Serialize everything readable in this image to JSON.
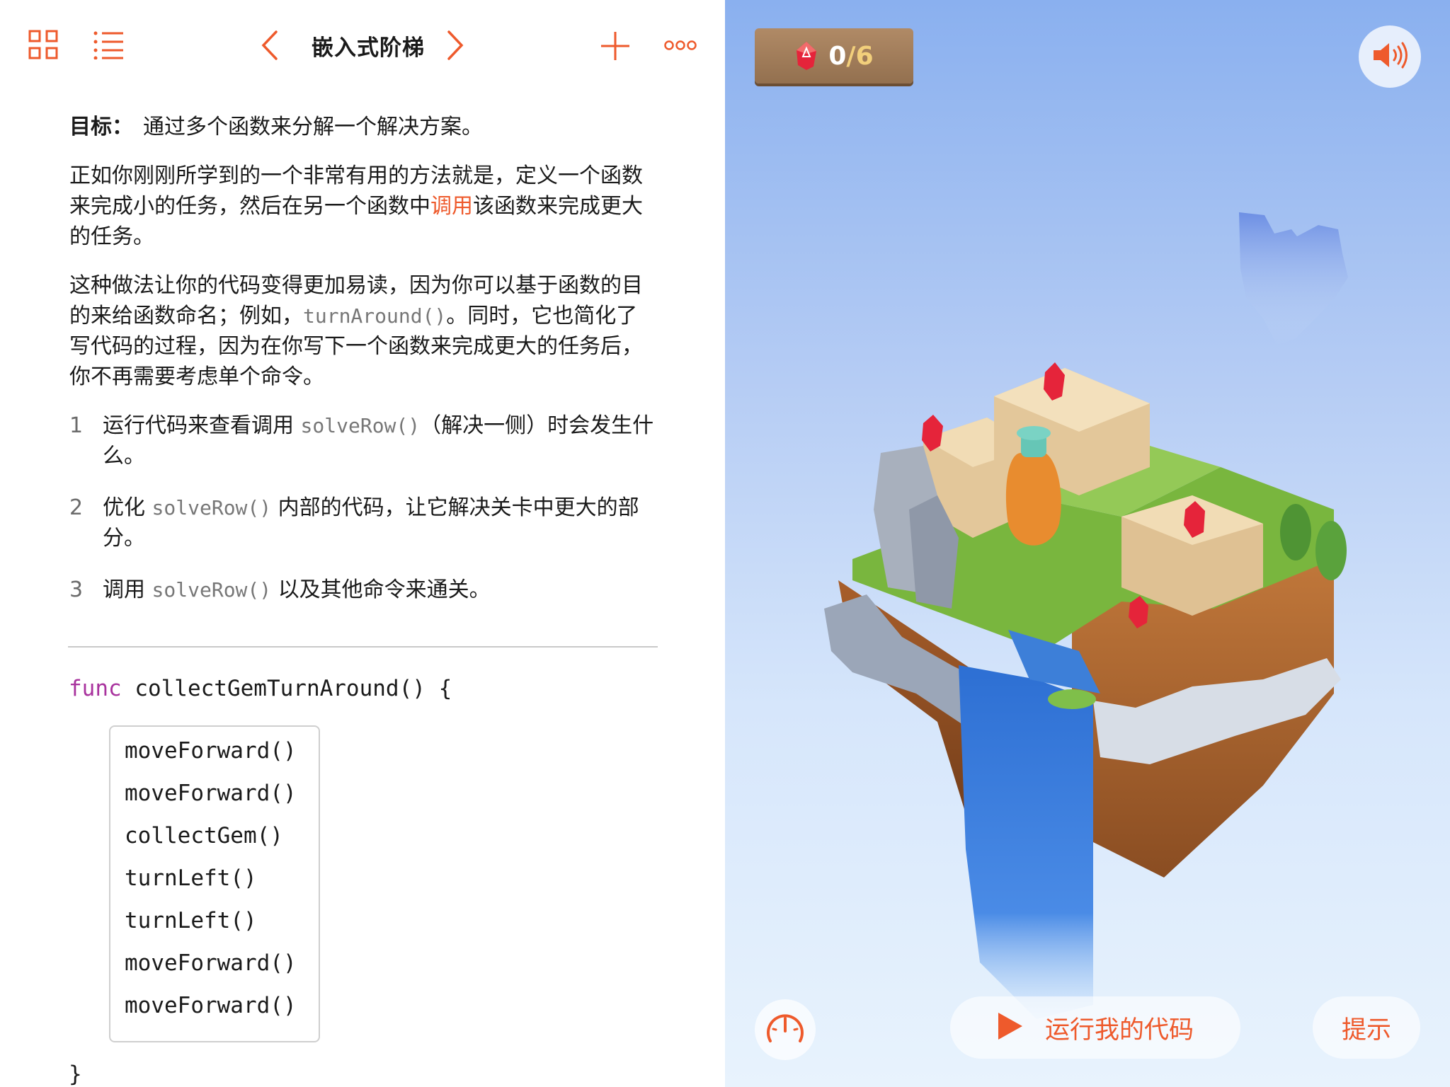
{
  "toolbar": {
    "title": "嵌入式阶梯"
  },
  "lesson": {
    "goal_label": "目标：",
    "goal_text": "通过多个函数来分解一个解决方案。",
    "p1_before": "正如你刚刚所学到的一个非常有用的方法就是，定义一个函数来完成小的任务，然后在另一个函数中",
    "p1_link": "调用",
    "p1_after": "该函数来完成更大的任务。",
    "p2_before": "这种做法让你的代码变得更加易读，因为你可以基于函数的目的来给函数命名；例如，",
    "p2_code": "turnAround()",
    "p2_after": "。同时，它也简化了写代码的过程，因为在你写下一个函数来完成更大的任务后，你不再需要考虑单个命令。",
    "steps": [
      {
        "num": "1",
        "before": "运行代码来查看调用 ",
        "code": "solveRow()",
        "after": "（解决一侧）时会发生什么。"
      },
      {
        "num": "2",
        "before": "优化 ",
        "code": "solveRow()",
        "after": " 内部的代码，让它解决关卡中更大的部分。"
      },
      {
        "num": "3",
        "before": "调用 ",
        "code": "solveRow()",
        "after": " 以及其他命令来通关。"
      }
    ]
  },
  "code": {
    "keyword": "func",
    "signature": " collectGemTurnAround() {",
    "lines": [
      "moveForward()",
      "moveForward()",
      "collectGem()",
      "turnLeft()",
      "turnLeft()",
      "moveForward()",
      "moveForward()"
    ],
    "close": "}"
  },
  "game": {
    "gems_collected": "0",
    "gems_total": "/6",
    "run_label": "运行我的代码",
    "hint_label": "提示"
  },
  "colors": {
    "accent": "#ee5a2c",
    "keyword": "#a9339e",
    "inline_code": "#777777"
  }
}
